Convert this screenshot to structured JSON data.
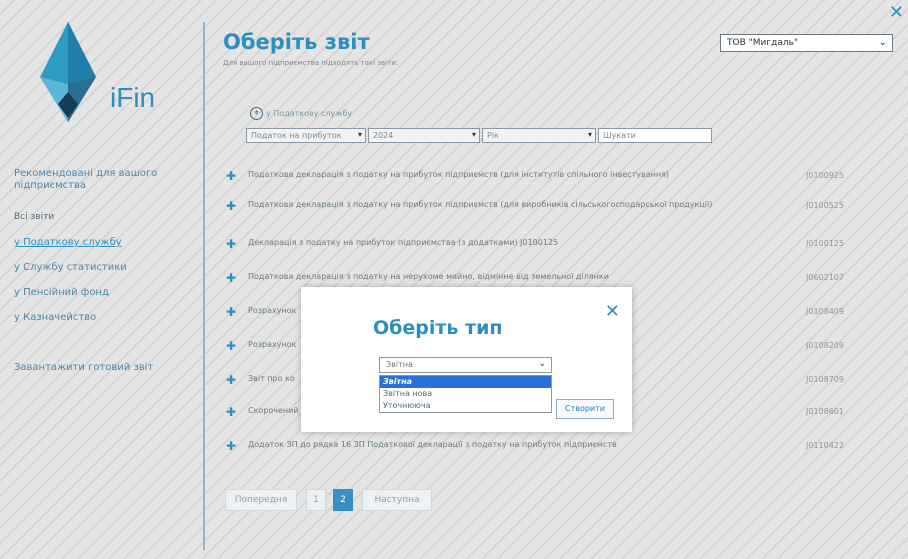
{
  "header": {
    "title": "Оберіть звіт",
    "subtitle": "Для вашого підприємства підходять такі звіти:",
    "company": "ТОВ \"Мигдаль\"",
    "logo_text": "iFin"
  },
  "sidebar": {
    "recommended": "Рекомендовані для вашого підприємства",
    "all_reports": "Всі звіти",
    "items": [
      {
        "label": "у Податкову службу"
      },
      {
        "label": "у Службу статистики"
      },
      {
        "label": "у Пенсійний фонд"
      },
      {
        "label": "у Казначейство"
      }
    ],
    "upload": "Завантажити готовий звіт"
  },
  "filters": {
    "service": "у Податкову службу",
    "report_type": "Податок на прибуток",
    "year": "2024",
    "period": "Рік",
    "search_placeholder": "Шукати"
  },
  "reports": [
    {
      "name": "Податкова декларація з податку на прибуток підприємств (для інститутів спільного інвестування)",
      "code": "J0100925"
    },
    {
      "name": "Податкова декларація з податку на прибуток підприємств (для виробників сільськогосподарської продукції)",
      "code": "J0100525"
    },
    {
      "name": "Декларація з податку на прибуток підприємства (з додатками) J0100125",
      "code": "J0100125"
    },
    {
      "name": "Податкова декларація з податку на нерухоме майно, відмінне від земельної ділянки",
      "code": "J0602107"
    },
    {
      "name": "Розрахунок",
      "code": "J0108409"
    },
    {
      "name": "Розрахунок",
      "code": "J0108209"
    },
    {
      "name": "Звіт про ко",
      "code": "J0108709"
    },
    {
      "name": "Скорочений",
      "code": "J0108601"
    },
    {
      "name": "Додаток ЗП до рядка 16 ЗП Податкової декларації з податку на прибуток підприємств",
      "code": "J0110422"
    }
  ],
  "pagination": {
    "prev": "Попередня",
    "pages": [
      "1",
      "2"
    ],
    "next": "Наступна"
  },
  "modal": {
    "title": "Оберіть тип",
    "selected": "Звітна",
    "options": [
      "Звітна",
      "Звітна нова",
      "Уточнююча"
    ],
    "create": "Створити"
  },
  "colors": {
    "accent": "#2d8fbf",
    "selected_option": "#2b6fd8"
  }
}
